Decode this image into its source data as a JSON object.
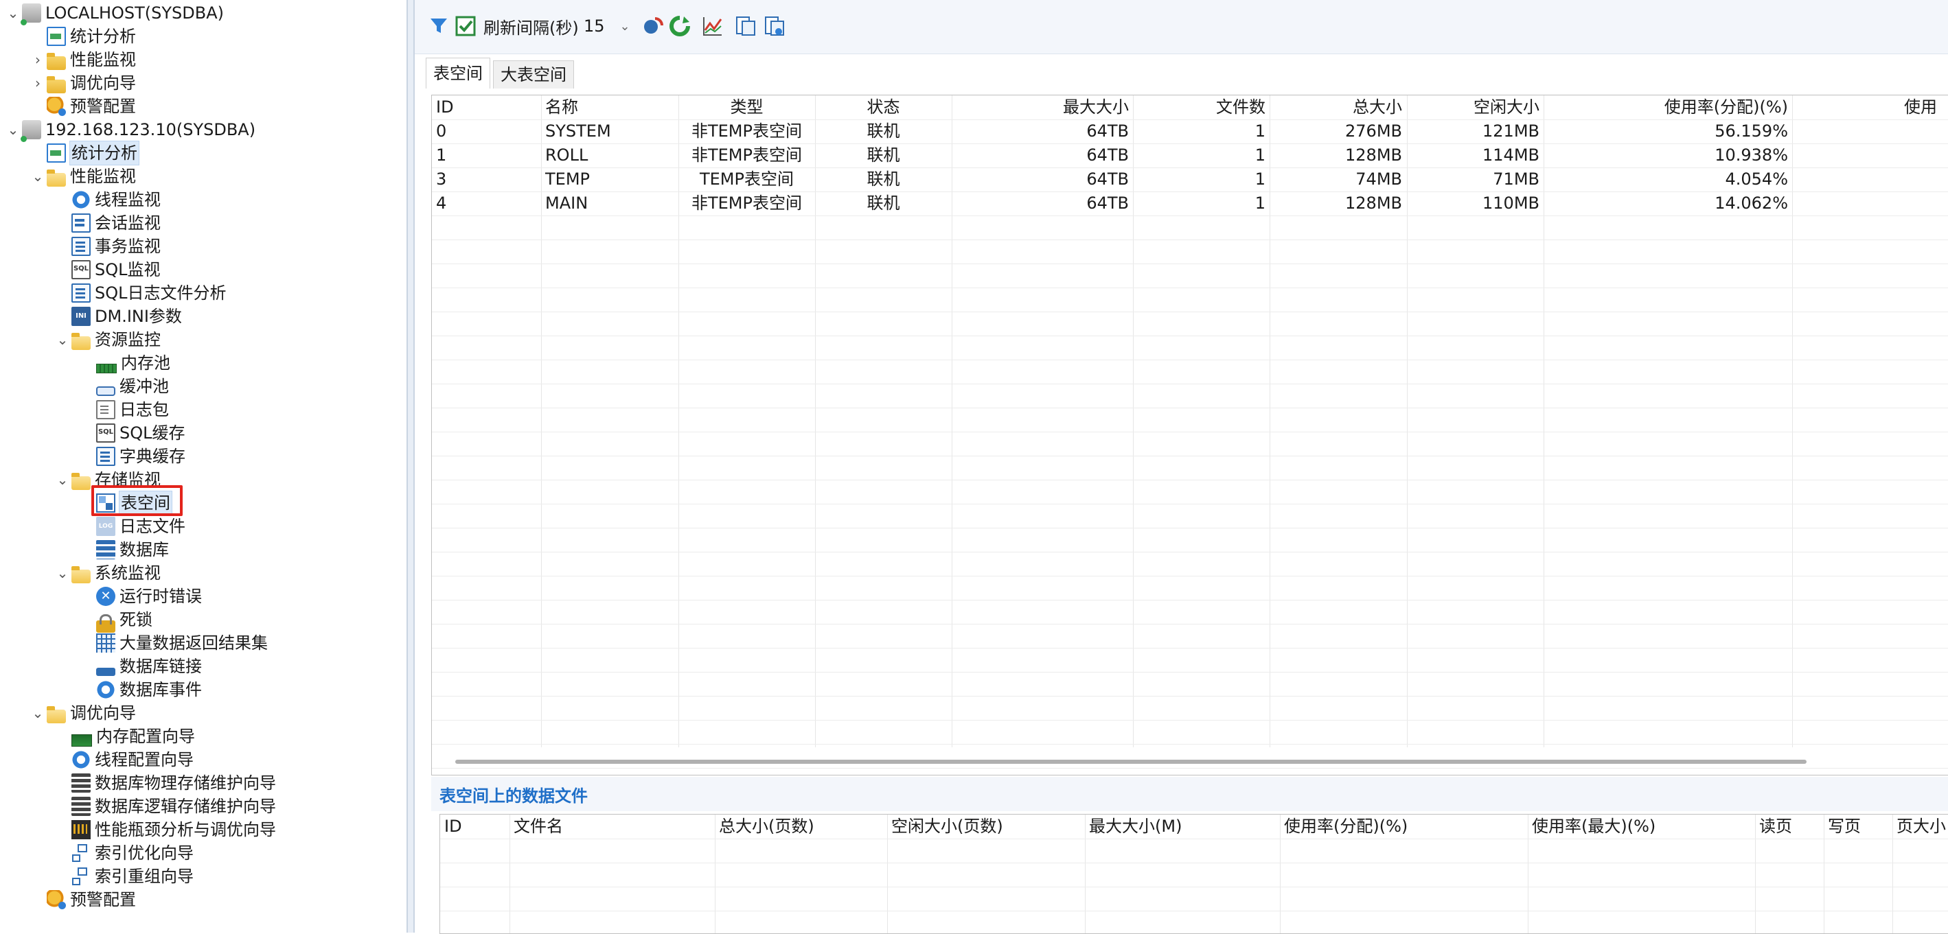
{
  "tree": {
    "items": [
      {
        "label": "LOCALHOST(SYSDBA)",
        "icon": "database-server-icon"
      },
      {
        "label": "统计分析",
        "icon": "stats-chart-icon"
      },
      {
        "label": "性能监视",
        "icon": "folder-icon"
      },
      {
        "label": "调优向导",
        "icon": "folder-icon"
      },
      {
        "label": "预警配置",
        "icon": "alarm-config-icon"
      },
      {
        "label": "192.168.123.10(SYSDBA)",
        "icon": "database-server-icon"
      },
      {
        "label": "统计分析",
        "icon": "stats-chart-icon"
      },
      {
        "label": "性能监视",
        "icon": "folder-open-icon"
      },
      {
        "label": "线程监视",
        "icon": "gear-icon"
      },
      {
        "label": "会话监视",
        "icon": "session-card-icon"
      },
      {
        "label": "事务监视",
        "icon": "transaction-doc-icon"
      },
      {
        "label": "SQL监视",
        "icon": "sql-icon"
      },
      {
        "label": "SQL日志文件分析",
        "icon": "sql-log-icon"
      },
      {
        "label": "DM.INI参数",
        "icon": "ini-file-icon"
      },
      {
        "label": "资源监控",
        "icon": "folder-open-icon"
      },
      {
        "label": "内存池",
        "icon": "memory-icon"
      },
      {
        "label": "缓冲池",
        "icon": "buffer-icon"
      },
      {
        "label": "日志包",
        "icon": "log-package-icon"
      },
      {
        "label": "SQL缓存",
        "icon": "sql-cache-icon"
      },
      {
        "label": "字典缓存",
        "icon": "dictionary-icon"
      },
      {
        "label": "存储监视",
        "icon": "folder-open-icon"
      },
      {
        "label": "表空间",
        "icon": "tablespace-icon"
      },
      {
        "label": "日志文件",
        "icon": "log-file-icon"
      },
      {
        "label": "数据库",
        "icon": "database-stack-icon"
      },
      {
        "label": "系统监视",
        "icon": "folder-open-icon"
      },
      {
        "label": "运行时错误",
        "icon": "error-x-icon"
      },
      {
        "label": "死锁",
        "icon": "lock-icon"
      },
      {
        "label": "大量数据返回结果集",
        "icon": "grid-table-icon"
      },
      {
        "label": "数据库链接",
        "icon": "link-icon"
      },
      {
        "label": "数据库事件",
        "icon": "gear-icon"
      },
      {
        "label": "调优向导",
        "icon": "folder-open-icon"
      },
      {
        "label": "内存配置向导",
        "icon": "memory-wizard-icon"
      },
      {
        "label": "线程配置向导",
        "icon": "gear-icon"
      },
      {
        "label": "数据库物理存储维护向导",
        "icon": "server-storage-icon"
      },
      {
        "label": "数据库逻辑存储维护向导",
        "icon": "logical-storage-icon"
      },
      {
        "label": "性能瓶颈分析与调优向导",
        "icon": "performance-wave-icon"
      },
      {
        "label": "索引优化向导",
        "icon": "index-tree-icon"
      },
      {
        "label": "索引重组向导",
        "icon": "index-tree-icon"
      },
      {
        "label": "预警配置",
        "icon": "alarm-config-icon"
      }
    ]
  },
  "toolbar": {
    "refresh_label": "刷新间隔(秒)",
    "refresh_value": "15",
    "icons": [
      "filter-icon",
      "checkbox-icon",
      "sync-icon",
      "refresh-icon",
      "chart-line-icon",
      "export-icon",
      "export-settings-icon"
    ]
  },
  "tabs": [
    {
      "label": "表空间",
      "active": true
    },
    {
      "label": "大表空间",
      "active": false
    }
  ],
  "table": {
    "headers": [
      "ID",
      "名称",
      "类型",
      "状态",
      "最大大小",
      "文件数",
      "总大小",
      "空闲大小",
      "使用率(分配)(%)",
      "使用"
    ],
    "rows": [
      [
        "0",
        "SYSTEM",
        "非TEMP表空间",
        "联机",
        "64TB",
        "1",
        "276MB",
        "121MB",
        "56.159%",
        ""
      ],
      [
        "1",
        "ROLL",
        "非TEMP表空间",
        "联机",
        "64TB",
        "1",
        "128MB",
        "114MB",
        "10.938%",
        ""
      ],
      [
        "3",
        "TEMP",
        "TEMP表空间",
        "联机",
        "64TB",
        "1",
        "74MB",
        "71MB",
        "4.054%",
        ""
      ],
      [
        "4",
        "MAIN",
        "非TEMP表空间",
        "联机",
        "64TB",
        "1",
        "128MB",
        "110MB",
        "14.062%",
        ""
      ]
    ]
  },
  "datafiles": {
    "title": "表空间上的数据文件",
    "headers": [
      "ID",
      "文件名",
      "总大小(页数)",
      "空闲大小(页数)",
      "最大大小(M)",
      "使用率(分配)(%)",
      "使用率(最大)(%)",
      "读页",
      "写页",
      "页大小"
    ]
  },
  "colors": {
    "accent": "#2f6db3",
    "highlight_box": "#e3241c",
    "section_title": "#1f6fc8"
  }
}
